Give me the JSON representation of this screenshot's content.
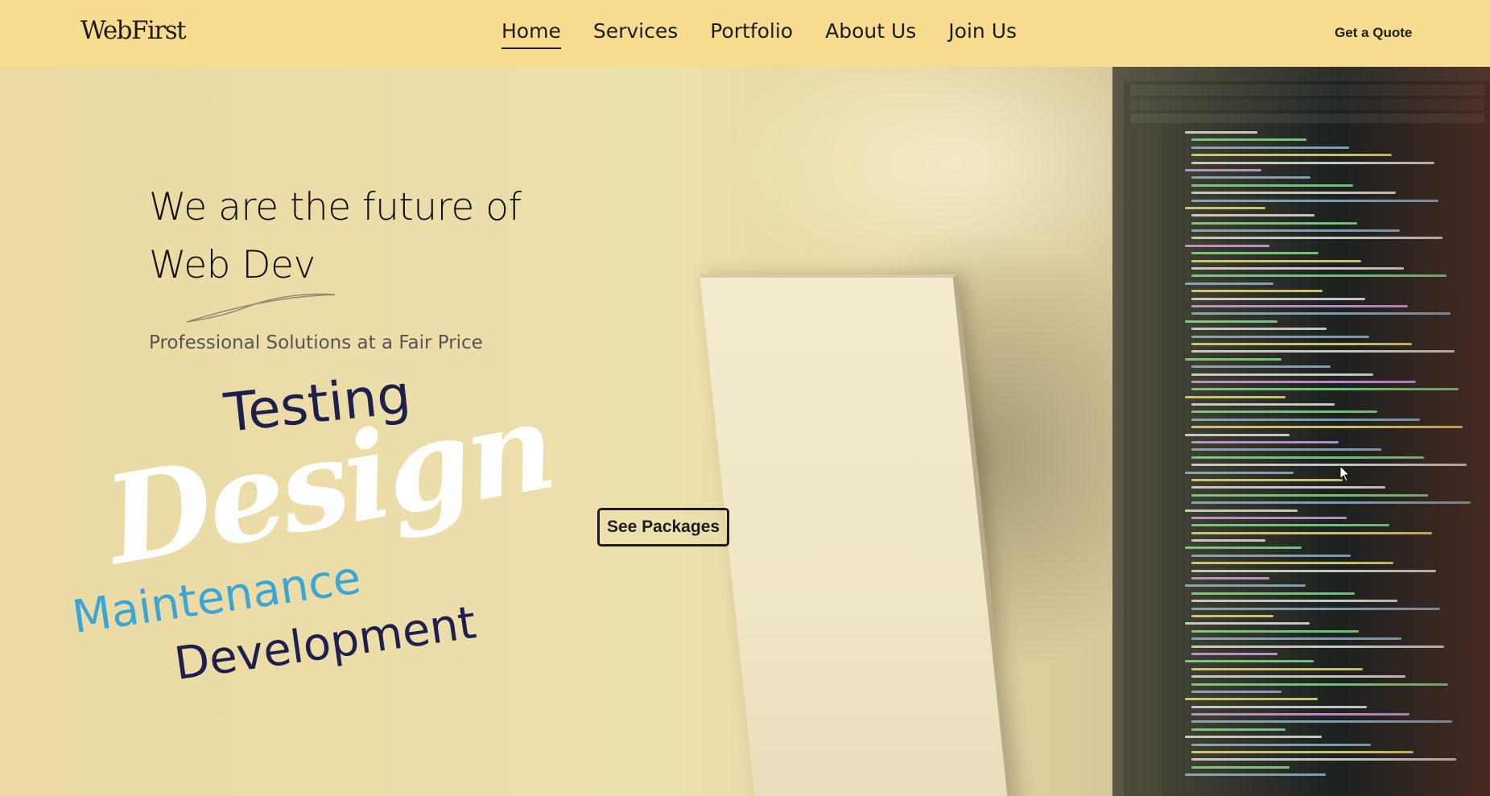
{
  "header": {
    "logo": "WebFirst",
    "nav": [
      {
        "label": "Home",
        "active": true
      },
      {
        "label": "Services",
        "active": false
      },
      {
        "label": "Portfolio",
        "active": false
      },
      {
        "label": "About Us",
        "active": false
      },
      {
        "label": "Join Us",
        "active": false
      }
    ],
    "cta_label": "Get a Quote"
  },
  "hero": {
    "headline_line1": "We are the future of",
    "headline_line2": "Web Dev",
    "subhead": "Professional Solutions at a Fair Price",
    "word_cloud": {
      "testing": "Testing",
      "design": "Design",
      "maintenance": "Maintenance",
      "development": "Development"
    },
    "packages_button": "See Packages"
  },
  "colors": {
    "header_bg": "#f8dc92",
    "navy": "#1e1f4d",
    "accent_blue": "#3aa6d5",
    "text_dark": "#1d1d1d"
  }
}
